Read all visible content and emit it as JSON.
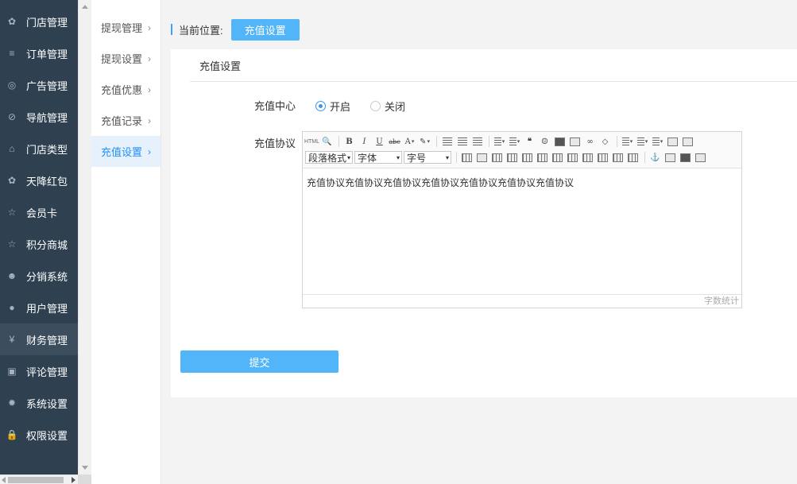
{
  "nav": {
    "items": [
      {
        "label": "门店管理",
        "icon": "cubes-icon",
        "glyph": "✿",
        "active": false
      },
      {
        "label": "订单管理",
        "icon": "list-icon",
        "glyph": "≡",
        "active": false
      },
      {
        "label": "广告管理",
        "icon": "lifebuoy-icon",
        "glyph": "◎",
        "active": false
      },
      {
        "label": "导航管理",
        "icon": "compass-icon",
        "glyph": "⊘",
        "active": false
      },
      {
        "label": "门店类型",
        "icon": "bank-icon",
        "glyph": "⌂",
        "active": false
      },
      {
        "label": "天降红包",
        "icon": "cubes-icon",
        "glyph": "✿",
        "active": false
      },
      {
        "label": "会员卡",
        "icon": "star-icon",
        "glyph": "☆",
        "active": false
      },
      {
        "label": "积分商城",
        "icon": "star-icon",
        "glyph": "☆",
        "active": false
      },
      {
        "label": "分销系统",
        "icon": "users-icon",
        "glyph": "☻",
        "active": false
      },
      {
        "label": "用户管理",
        "icon": "user-icon",
        "glyph": "●",
        "active": false
      },
      {
        "label": "财务管理",
        "icon": "yen-icon",
        "glyph": "¥",
        "active": true
      },
      {
        "label": "评论管理",
        "icon": "money-icon",
        "glyph": "▣",
        "active": false
      },
      {
        "label": "系统设置",
        "icon": "gear-icon",
        "glyph": "✹",
        "active": false
      },
      {
        "label": "权限设置",
        "icon": "lock-icon",
        "glyph": "🔒",
        "active": false
      }
    ]
  },
  "submenu": {
    "items": [
      {
        "label": "提现管理",
        "active": false
      },
      {
        "label": "提现设置",
        "active": false
      },
      {
        "label": "充值优惠",
        "active": false
      },
      {
        "label": "充值记录",
        "active": false
      },
      {
        "label": "充值设置",
        "active": true
      }
    ],
    "chevron": "›"
  },
  "breadcrumb": {
    "prefix": "当前位置:",
    "current": "充值设置"
  },
  "panel": {
    "tab_label": "充值设置",
    "recharge_center": {
      "label": "充值中心",
      "options": [
        {
          "label": "开启",
          "selected": true
        },
        {
          "label": "关闭",
          "selected": false
        }
      ]
    },
    "agreement": {
      "label": "充值协议",
      "paragraph_select": "段落格式",
      "font_select": "字体",
      "size_select": "字号",
      "html_btn": "HTML",
      "content": "充值协议充值协议充值协议充值协议充值协议充值协议充值协议",
      "word_count": "字数统计"
    },
    "submit_label": "提交"
  },
  "colors": {
    "nav_bg": "#2f4050",
    "accent": "#52b4f9",
    "active_sub_bg": "#e6f1fb"
  }
}
